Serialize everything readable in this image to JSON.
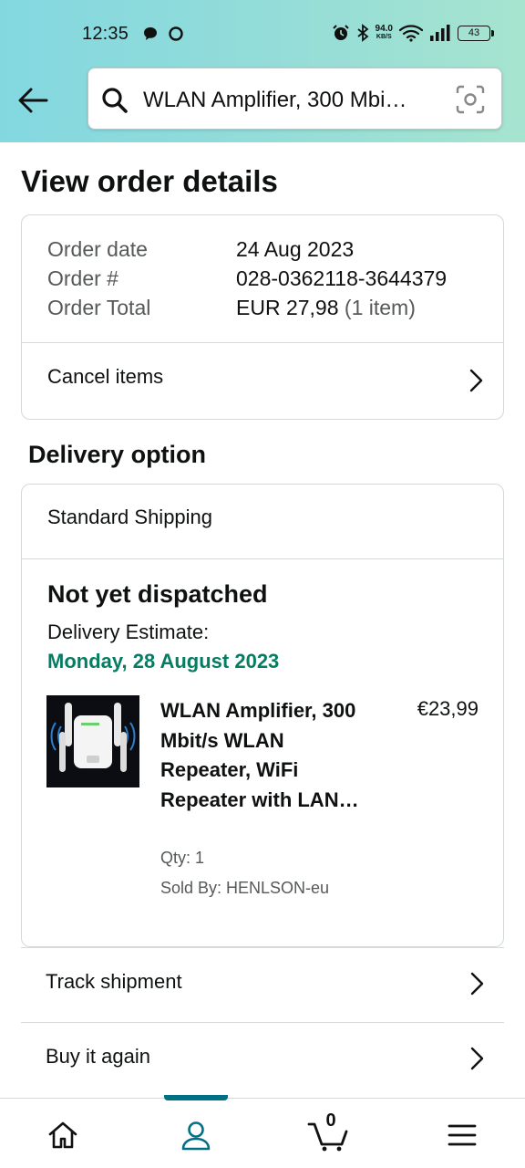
{
  "status_bar": {
    "time": "12:35",
    "net_speed_value": "94.0",
    "net_speed_unit": "KB/S",
    "battery": "43"
  },
  "header": {
    "search_text": "WLAN Amplifier, 300 Mbi…",
    "back_icon": "arrow-left-icon",
    "search_icon": "search-icon",
    "camera_icon": "camera-scan-icon"
  },
  "page_title": "View order details",
  "order_summary": {
    "date_label": "Order date",
    "date_value": "24 Aug 2023",
    "number_label": "Order #",
    "number_value": "028-0362118-3644379",
    "total_label": "Order Total",
    "total_value": "EUR 27,98",
    "total_items": "(1 item)",
    "cancel_label": "Cancel items"
  },
  "delivery": {
    "section_title": "Delivery option",
    "method": "Standard Shipping",
    "status": "Not yet dispatched",
    "estimate_label": "Delivery Estimate:",
    "estimate_date": "Monday, 28 August 2023",
    "estimate_color": "#067d62"
  },
  "product": {
    "name": "WLAN Amplifier, 300 Mbit/s WLAN Repeater, WiFi Repeater with LAN…",
    "price": "€23,99",
    "qty": "Qty: 1",
    "seller": "Sold By: HENLSON-eu"
  },
  "actions": {
    "track_label": "Track shipment",
    "buy_again_label": "Buy it again"
  },
  "bottom_nav": {
    "active": "account",
    "accent_color": "#007185",
    "cart_count": "0",
    "items": [
      "home-icon",
      "account-icon",
      "cart-icon",
      "menu-icon"
    ]
  }
}
